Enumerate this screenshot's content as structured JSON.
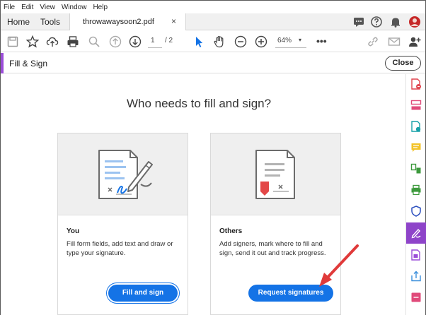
{
  "menu": [
    "File",
    "Edit",
    "View",
    "Window",
    "Help"
  ],
  "tabs": {
    "home": "Home",
    "tools": "Tools",
    "document": "throwawaysoon2.pdf",
    "close_glyph": "×"
  },
  "toolbar": {
    "page_current": "1",
    "page_total": "/  2",
    "zoom": "64%",
    "zoom_caret": "▾",
    "more": "•••"
  },
  "fill_sign": {
    "title": "Fill & Sign",
    "close_label": "Close",
    "accent_color": "#9b4dd8"
  },
  "main": {
    "heading": "Who needs to fill and sign?",
    "cards": [
      {
        "title": "You",
        "text": "Fill form fields, add text and draw or type your signature.",
        "button": "Fill and sign"
      },
      {
        "title": "Others",
        "text": "Add signers, mark where to fill and sign, send it out and track progress.",
        "button": "Request signatures"
      }
    ]
  },
  "colors": {
    "primary_button": "#1473e6",
    "annotation_arrow": "#e03a3a"
  },
  "right_rail_icons": [
    "export-pdf-icon",
    "organize-pages-icon",
    "edit-pdf-icon",
    "comment-icon",
    "compress-icon",
    "print-production-icon",
    "protect-icon",
    "fill-sign-icon",
    "create-pdf-icon",
    "share-icon",
    "more-tools-icon"
  ]
}
